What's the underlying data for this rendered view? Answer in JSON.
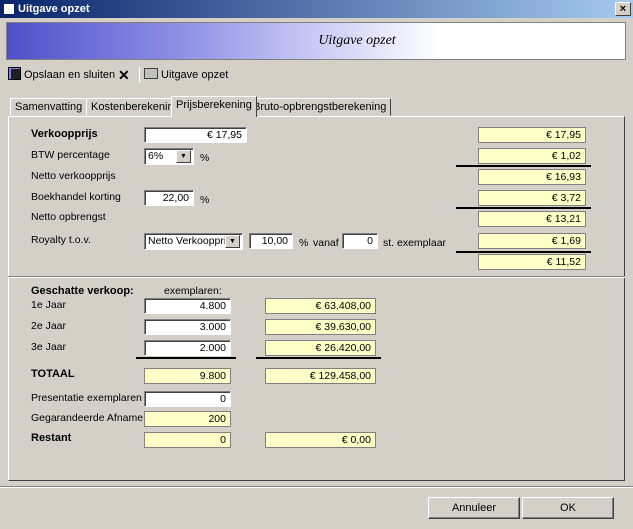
{
  "window": {
    "title": "Uitgave opzet",
    "close_label": "×"
  },
  "banner": {
    "title": "Uitgave opzet"
  },
  "toolbar": {
    "save_close": "Opslaan en sluiten",
    "delete": "✕",
    "print": "Uitgave opzet"
  },
  "tabs": [
    "Samenvatting",
    "Kostenberekening",
    "Prijsberekening",
    "Bruto-opbrengstberekening"
  ],
  "price": {
    "verkoopprijs_label": "Verkoopprijs",
    "verkoopprijs_value": "€ 17,95",
    "verkoopprijs_out": "€ 17,95",
    "btw_label": "BTW percentage",
    "btw_value": "6%",
    "btw_unit": "%",
    "btw_out": "€ 1,02",
    "netto_label": "Netto verkoopprijs",
    "netto_out": "€ 16,93",
    "korting_label": "Boekhandel korting",
    "korting_value": "22,00",
    "korting_unit": "%",
    "korting_out": "€ 3,72",
    "opbrengst_label": "Netto opbrengst",
    "opbrengst_out": "€ 13,21",
    "royalty_label": "Royalty t.o.v.",
    "royalty_basis": "Netto Verkoopprijs",
    "royalty_pct": "10,00",
    "royalty_pct_unit": "%",
    "royalty_vanaf": "vanaf",
    "royalty_from": "0",
    "royalty_from_unit": "st. exemplaar",
    "royalty_out": "€ 1,69",
    "result_out": "€ 11,52"
  },
  "sales": {
    "header": "Geschatte verkoop:",
    "col_header": "exemplaren:",
    "rows": [
      {
        "label": "1e Jaar",
        "qty": "4.800",
        "amount": "€ 63.408,00"
      },
      {
        "label": "2e Jaar",
        "qty": "3.000",
        "amount": "€ 39.630,00"
      },
      {
        "label": "3e Jaar",
        "qty": "2.000",
        "amount": "€ 26.420,00"
      }
    ],
    "total_label": "TOTAAL",
    "total_qty": "9.800",
    "total_amount": "€ 129.458,00",
    "presentatie_label": "Presentatie exemplaren",
    "presentatie_value": "0",
    "gegarandeerd_label": "Gegarandeerde Afname",
    "gegarandeerd_value": "200",
    "restant_label": "Restant",
    "restant_qty": "0",
    "restant_amount": "€ 0,00"
  },
  "footer": {
    "cancel": "Annuleer",
    "ok": "OK"
  },
  "colors": {
    "output_bg": "#ffffc8",
    "dialog_bg": "#d4d0c8"
  }
}
